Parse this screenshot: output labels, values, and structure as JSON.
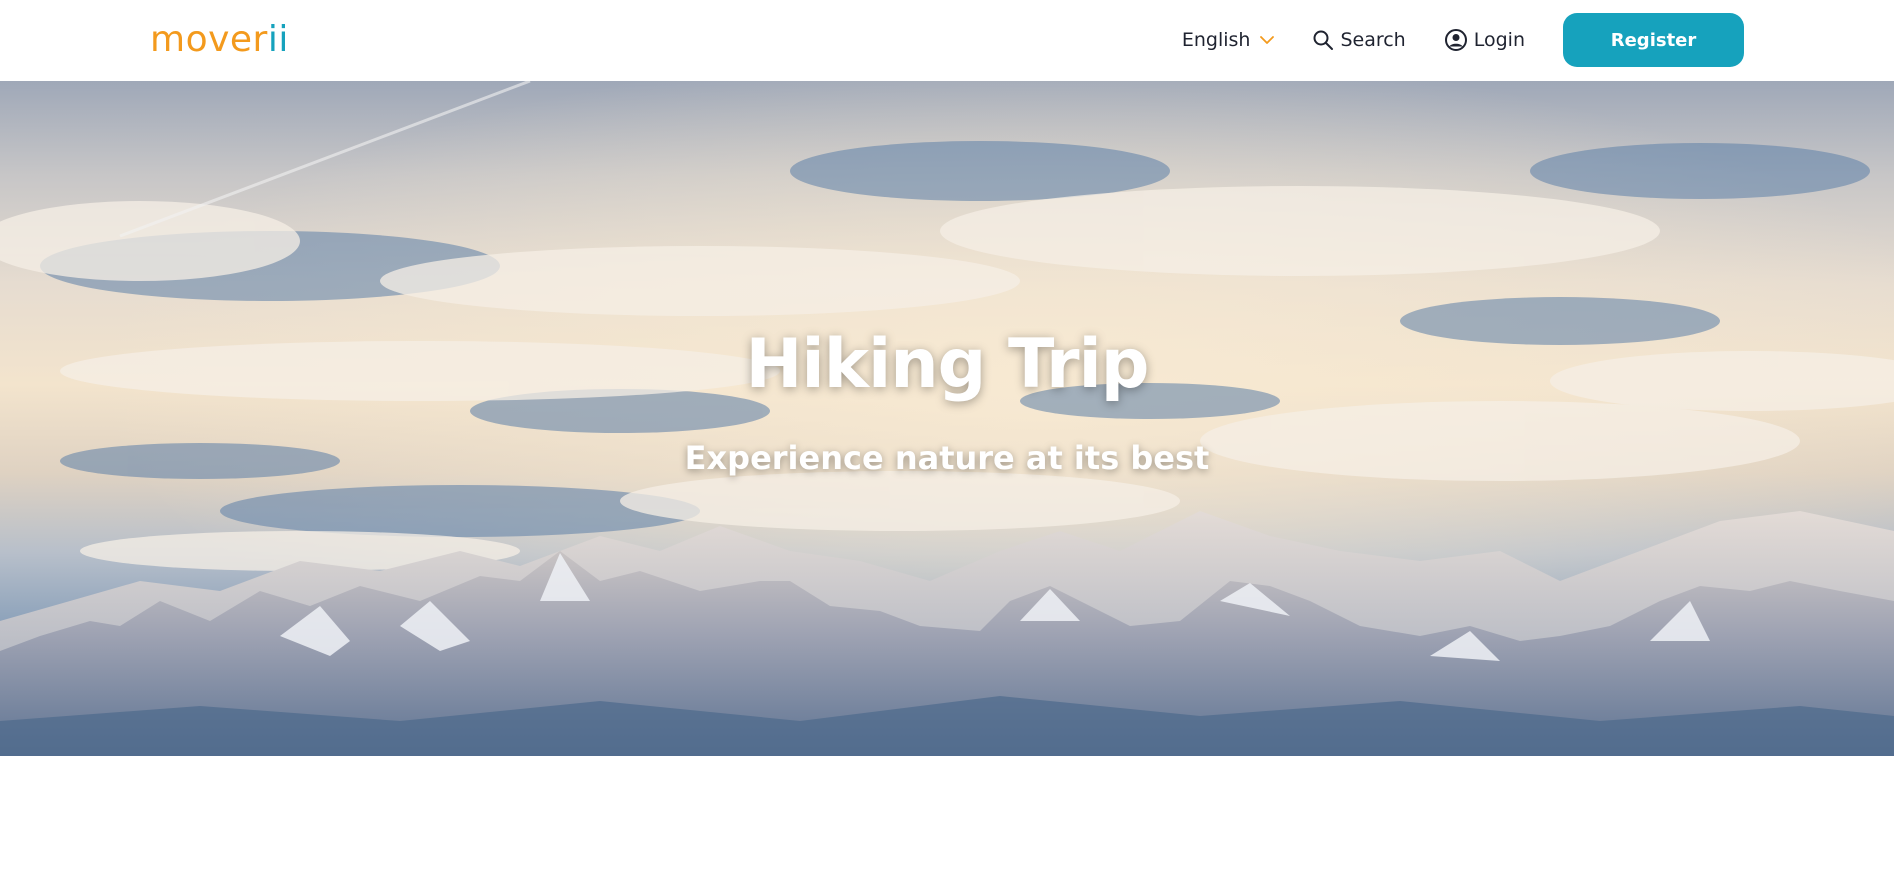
{
  "header": {
    "logo_main": "mover",
    "logo_accent": "ii",
    "language": "English",
    "search_label": "Search",
    "login_label": "Login",
    "register_label": "Register"
  },
  "hero": {
    "title": "Hiking Trip",
    "subtitle": "Experience nature at its best"
  },
  "colors": {
    "brand_orange": "#f39a1d",
    "brand_teal": "#16a2bd",
    "text_dark": "#1f2330"
  },
  "icons": {
    "language": "chevron-down-icon",
    "search": "search-icon",
    "login": "user-circle-icon"
  }
}
